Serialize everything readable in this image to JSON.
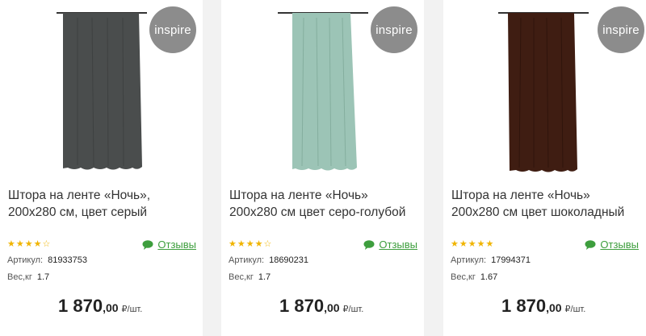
{
  "products": [
    {
      "badge": "inspire",
      "title_line1": "Штора на ленте «Ночь»,",
      "title_line2": "200х280 см, цвет серый",
      "rating_stars": "★★★★☆",
      "rating_value": 4,
      "reviews_label": "Отзывы",
      "article_label": "Артикул:",
      "article_value": "81933753",
      "weight_label": "Вес,кг",
      "weight_value": "1.7",
      "price_main": "1 870",
      "price_cents": ",00",
      "price_unit": "₽/шт.",
      "curtain_color": "#4a4d4d",
      "image": "gray-curtain"
    },
    {
      "badge": "inspire",
      "title_line1": "Штора на ленте «Ночь»",
      "title_line2": "200х280 см цвет серо-голубой",
      "rating_stars": "★★★★☆",
      "rating_value": 4,
      "reviews_label": "Отзывы",
      "article_label": "Артикул:",
      "article_value": "18690231",
      "weight_label": "Вес,кг",
      "weight_value": "1.7",
      "price_main": "1 870",
      "price_cents": ",00",
      "price_unit": "₽/шт.",
      "curtain_color": "#9cc4b6",
      "image": "grey-blue-curtain"
    },
    {
      "badge": "inspire",
      "title_line1": "Штора на ленте «Ночь»",
      "title_line2": "200х280 см цвет шоколадный",
      "rating_stars": "★★★★★",
      "rating_value": 4.5,
      "reviews_label": "Отзывы",
      "article_label": "Артикул:",
      "article_value": "17994371",
      "weight_label": "Вес,кг",
      "weight_value": "1.67",
      "price_main": "1 870",
      "price_cents": ",00",
      "price_unit": "₽/шт.",
      "curtain_color": "#3f1d12",
      "image": "chocolate-curtain"
    }
  ],
  "colors": {
    "accent_green": "#3d9e3d",
    "star": "#f0b400",
    "badge_bg": "#8c8c8c"
  },
  "icons": {
    "reviews": "speech-bubble-icon",
    "rating": "star-icon"
  }
}
